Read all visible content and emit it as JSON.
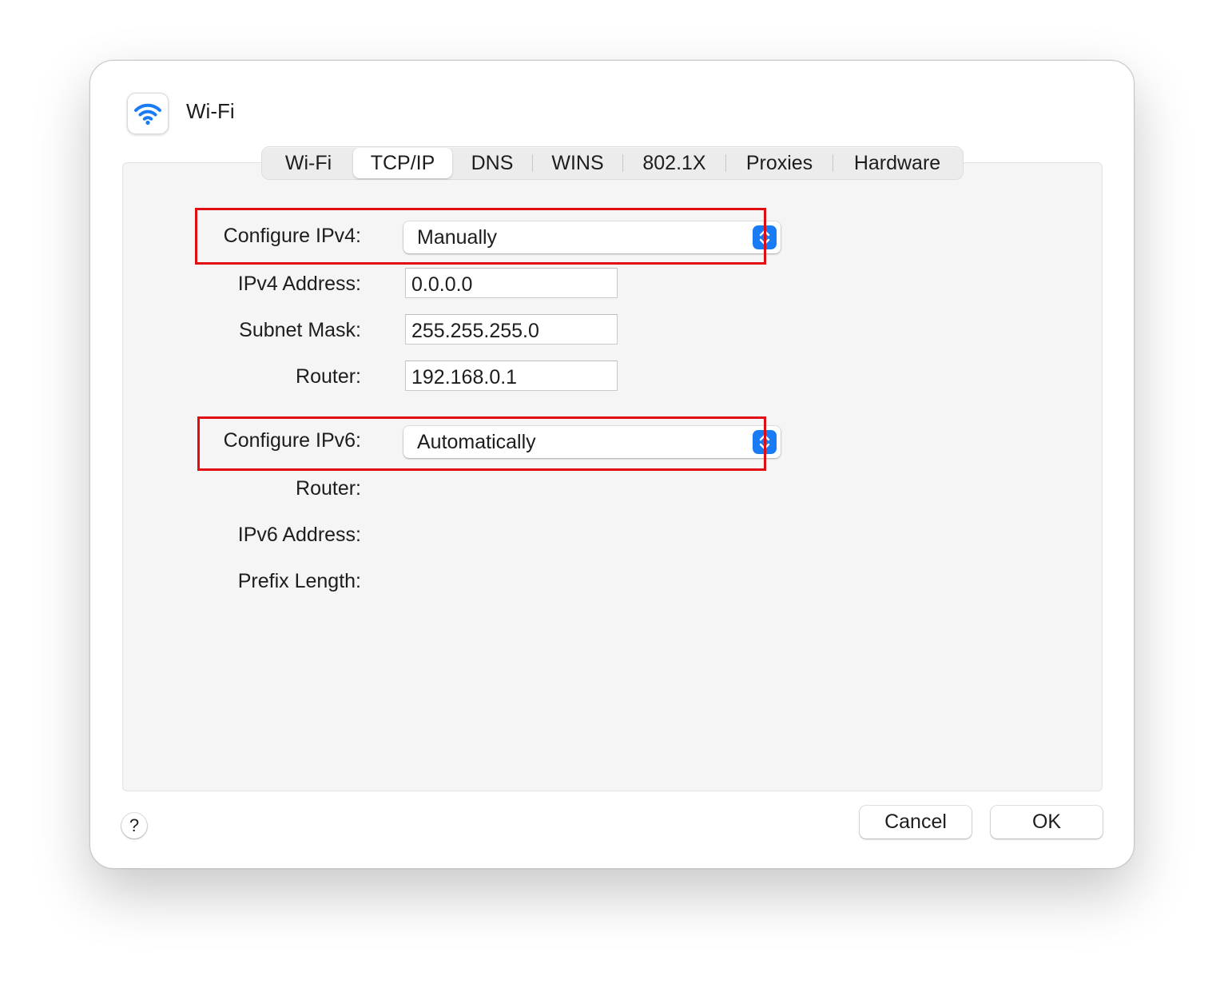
{
  "window": {
    "title": "Wi-Fi",
    "icon": "wifi-icon"
  },
  "tabs": [
    {
      "label": "Wi-Fi",
      "active": false
    },
    {
      "label": "TCP/IP",
      "active": true
    },
    {
      "label": "DNS",
      "active": false
    },
    {
      "label": "WINS",
      "active": false
    },
    {
      "label": "802.1X",
      "active": false
    },
    {
      "label": "Proxies",
      "active": false
    },
    {
      "label": "Hardware",
      "active": false
    }
  ],
  "ipv4": {
    "configure_label": "Configure IPv4:",
    "configure_value": "Manually",
    "address_label": "IPv4 Address:",
    "address_value": "0.0.0.0",
    "subnet_label": "Subnet Mask:",
    "subnet_value": "255.255.255.0",
    "router_label": "Router:",
    "router_value": "192.168.0.1"
  },
  "ipv6": {
    "configure_label": "Configure IPv6:",
    "configure_value": "Automatically",
    "router_label": "Router:",
    "address_label": "IPv6 Address:",
    "prefix_label": "Prefix Length:"
  },
  "footer": {
    "help_label": "?",
    "cancel_label": "Cancel",
    "ok_label": "OK"
  },
  "colors": {
    "accent": "#1a7cf5",
    "highlight": "#e00d12",
    "panel_bg": "#f5f5f5"
  }
}
